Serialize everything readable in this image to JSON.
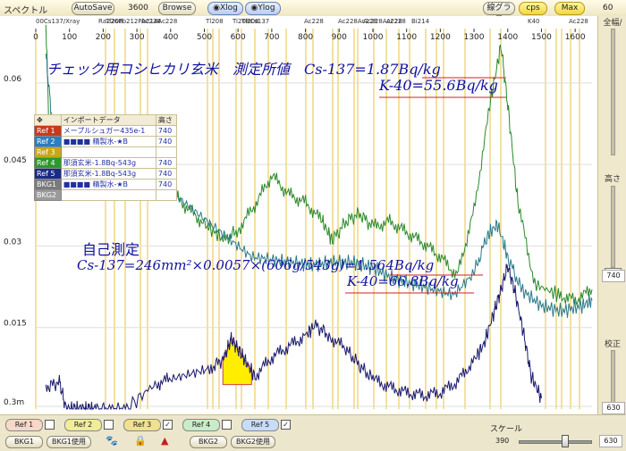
{
  "window": {
    "title": "スペクトル"
  },
  "toolbar": {
    "autosave": "AutoSave",
    "count": "3600",
    "browse": "Browse",
    "xlog": "Xlog",
    "ylog": "Ylog",
    "linegraph": "線グラフ",
    "cps": "cps",
    "max": "Max",
    "right_value": "60"
  },
  "right_panel": {
    "top_label": "全幅/",
    "height_label": "高さ",
    "height_value": "740",
    "calib_label": "校正",
    "calib_value": "630"
  },
  "isotopes": [
    "00Cs137/Xray",
    "Ra226Pb212Pb214Ac228",
    "Tl208",
    "Ac228",
    "Tl208",
    "Tl208",
    "Ti208Cs137",
    "Ac228",
    "Ac228Ac228",
    "Ac228Ac228",
    "Bi214",
    "Ac228",
    "K40",
    "Ac228"
  ],
  "chart_data": {
    "type": "line",
    "xlim": [
      0,
      1650
    ],
    "x_ticks": [
      "0",
      "100",
      "200",
      "300",
      "400",
      "500",
      "600",
      "700",
      "800",
      "900",
      "1000",
      "1100",
      "1200",
      "1300",
      "1400",
      "1500",
      "1600"
    ],
    "y_ticks": [
      "0.06",
      "0.045",
      "0.03",
      "0.015",
      "0.3m"
    ],
    "series": [
      {
        "color": "#1a1a6e",
        "points": [
          [
            30,
            0.004
          ],
          [
            70,
            0.005
          ],
          [
            90,
            0.0
          ],
          [
            115,
            0.0
          ],
          [
            130,
            0.0
          ],
          [
            150,
            0.0
          ],
          [
            170,
            0.0
          ],
          [
            210,
            0.0
          ],
          [
            270,
            0.0
          ],
          [
            350,
            0.0045
          ],
          [
            400,
            0.0055
          ],
          [
            460,
            0.0065
          ],
          [
            520,
            0.0075
          ],
          [
            560,
            0.0095
          ],
          [
            580,
            0.013
          ],
          [
            600,
            0.011
          ],
          [
            620,
            0.009
          ],
          [
            650,
            0.006
          ],
          [
            700,
            0.0095
          ],
          [
            750,
            0.0115
          ],
          [
            800,
            0.0135
          ],
          [
            830,
            0.0155
          ],
          [
            870,
            0.0135
          ],
          [
            920,
            0.011
          ],
          [
            960,
            0.008
          ],
          [
            1000,
            0.0055
          ],
          [
            1050,
            0.004
          ],
          [
            1100,
            0.003
          ],
          [
            1150,
            0.0025
          ],
          [
            1200,
            0.003
          ],
          [
            1250,
            0.005
          ],
          [
            1300,
            0.009
          ],
          [
            1330,
            0.012
          ],
          [
            1360,
            0.018
          ],
          [
            1380,
            0.022
          ],
          [
            1400,
            0.0263
          ],
          [
            1420,
            0.022
          ],
          [
            1450,
            0.013
          ],
          [
            1470,
            0.006
          ],
          [
            1500,
            0.002
          ]
        ]
      },
      {
        "color": "#2a8a2a",
        "points": [
          [
            30,
            0.071
          ],
          [
            40,
            0.05
          ],
          [
            80,
            0.046
          ],
          [
            150,
            0.044
          ],
          [
            200,
            0.043
          ],
          [
            260,
            0.046
          ],
          [
            300,
            0.045
          ],
          [
            350,
            0.043
          ],
          [
            400,
            0.04
          ],
          [
            450,
            0.037
          ],
          [
            500,
            0.034
          ],
          [
            560,
            0.031
          ],
          [
            600,
            0.033
          ],
          [
            650,
            0.0375
          ],
          [
            700,
            0.043
          ],
          [
            750,
            0.0395
          ],
          [
            800,
            0.038
          ],
          [
            850,
            0.0345
          ],
          [
            880,
            0.031
          ],
          [
            920,
            0.0345
          ],
          [
            960,
            0.036
          ],
          [
            1000,
            0.0335
          ],
          [
            1050,
            0.0345
          ],
          [
            1100,
            0.0325
          ],
          [
            1150,
            0.0305
          ],
          [
            1200,
            0.028
          ],
          [
            1250,
            0.0245
          ],
          [
            1300,
            0.0365
          ],
          [
            1350,
            0.057
          ],
          [
            1380,
            0.067
          ],
          [
            1400,
            0.056
          ],
          [
            1430,
            0.038
          ],
          [
            1480,
            0.023
          ],
          [
            1550,
            0.021
          ],
          [
            1600,
            0.02
          ],
          [
            1650,
            0.022
          ]
        ]
      },
      {
        "color": "#2a7a8a",
        "points": [
          [
            30,
            0.065
          ],
          [
            50,
            0.052
          ],
          [
            80,
            0.048
          ],
          [
            120,
            0.046
          ],
          [
            160,
            0.045
          ],
          [
            200,
            0.0445
          ],
          [
            260,
            0.047
          ],
          [
            300,
            0.045
          ],
          [
            340,
            0.043
          ],
          [
            400,
            0.04
          ],
          [
            460,
            0.037
          ],
          [
            520,
            0.034
          ],
          [
            580,
            0.031
          ],
          [
            640,
            0.028
          ],
          [
            700,
            0.0275
          ],
          [
            760,
            0.027
          ],
          [
            820,
            0.0265
          ],
          [
            880,
            0.027
          ],
          [
            940,
            0.027
          ],
          [
            1000,
            0.026
          ],
          [
            1060,
            0.024
          ],
          [
            1120,
            0.023
          ],
          [
            1180,
            0.022
          ],
          [
            1240,
            0.021
          ],
          [
            1300,
            0.025
          ],
          [
            1340,
            0.032
          ],
          [
            1370,
            0.034
          ],
          [
            1400,
            0.028
          ],
          [
            1440,
            0.022
          ],
          [
            1500,
            0.019
          ],
          [
            1560,
            0.018
          ],
          [
            1620,
            0.019
          ],
          [
            1650,
            0.02
          ]
        ]
      }
    ],
    "highlight": {
      "x_range": [
        555,
        640
      ],
      "color": "#ffee00"
    }
  },
  "annotations": {
    "header_text": "チェック用コシヒカリ玄米　測定所値　Cs-137=1.87Bq/kg",
    "header_line2": "K-40=55.6Bq/kg",
    "self_title": "自己測定",
    "self_line1": "Cs-137=246mm²×0.0057×(606g/543g)=1.564Bq/kg",
    "self_line2": "K-40=66.8Bq/kg"
  },
  "ref_table": {
    "headers": [
      "✥",
      "インポートデータ",
      "高さ"
    ],
    "rows": [
      {
        "tag": "Ref 1",
        "tagcolor": "#c83a1a",
        "name": "メープルシュガー435e-1",
        "h": "740"
      },
      {
        "tag": "Ref 2",
        "tagcolor": "#2a7fbf",
        "name": "■■■■ 精製水-★B",
        "h": "740"
      },
      {
        "tag": "Ref 3",
        "tagcolor": "#c8a81a",
        "name": "",
        "h": ""
      },
      {
        "tag": "Ref 4",
        "tagcolor": "#2a9a2a",
        "name": "那須玄米-1.8Bq-543g",
        "h": "740"
      },
      {
        "tag": "Ref 5",
        "tagcolor": "#1a2a8a",
        "name": "那須玄米-1.8Bq-543g",
        "h": "740"
      },
      {
        "tag": "BKG1",
        "tagcolor": "#7a7a7a",
        "name": "■■■■ 精製水-★B",
        "h": "740"
      },
      {
        "tag": "BKG2",
        "tagcolor": "#9a9a9a",
        "name": "",
        "h": ""
      }
    ]
  },
  "bottom": {
    "refs": [
      {
        "label": "Ref 1",
        "color": "#f7d8c8",
        "checked": false
      },
      {
        "label": "Ref 2",
        "color": "#f0ec9a",
        "checked": false
      },
      {
        "label": "Ref 3",
        "color": "#f0e090",
        "checked": true
      },
      {
        "label": "Ref 4",
        "color": "#c8ecc8",
        "checked": false
      },
      {
        "label": "Ref 5",
        "color": "#c8dcf8",
        "checked": true
      }
    ],
    "bkg1": "BKG1",
    "bkg1_use": "BKG1使用",
    "bkg2": "BKG2",
    "bkg2_use": "BKG2使用",
    "scale_label": "スケール",
    "scale_value": "390"
  }
}
